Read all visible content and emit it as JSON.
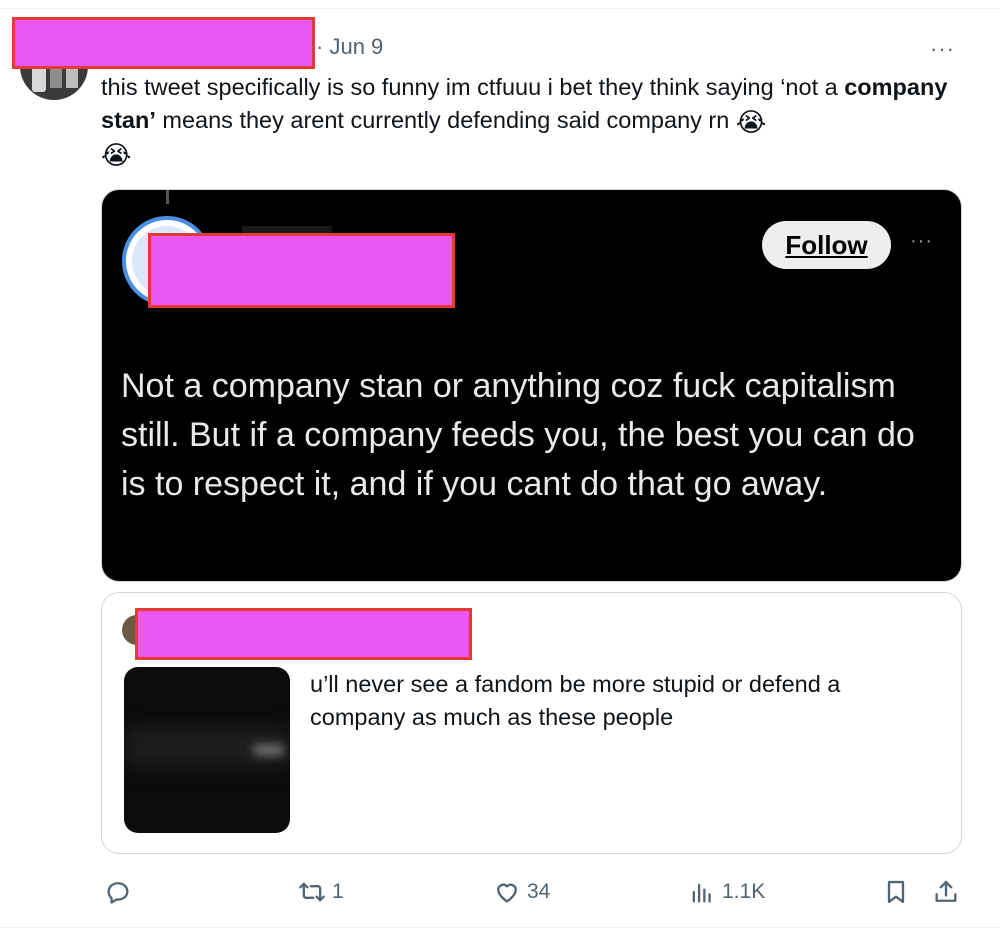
{
  "tweet": {
    "date": "Jun 9",
    "text_part1": "this tweet specifically is so funny im ctfuuu i bet they think saying ‘not a ",
    "text_bold": "company stan’",
    "text_part2": " means they arent currently defending said company rn ",
    "emoji": "😭",
    "more_icon": "···"
  },
  "media": {
    "follow_label": "Follow",
    "more_icon": "···",
    "text": "Not a company stan or anything coz fuck capitalism still. But if a company feeds you, the best you can do is to respect it, and if you cant do that go away."
  },
  "quote": {
    "text": "u’ll never see a fandom be more stupid or defend a company as much as these people"
  },
  "actions": {
    "reply_count": "",
    "retweet_count": "1",
    "like_count": "34",
    "views_count": "1.1K"
  },
  "colors": {
    "redaction_fill": "#ea58f3",
    "redaction_border": "#e53935",
    "muted_text": "#536471",
    "media_background": "#000000"
  }
}
